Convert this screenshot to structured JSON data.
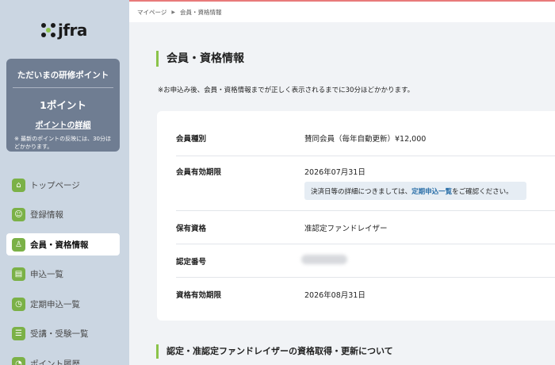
{
  "brand": {
    "logo_text": "jfra"
  },
  "points_card": {
    "title": "ただいまの研修ポイント",
    "value": "1ポイント",
    "link": "ポイントの詳細",
    "note": "※ 最新のポイントの反映には、30分ほどかかります。"
  },
  "nav": {
    "items": [
      {
        "label": "トップページ",
        "icon": "home-icon",
        "glyph": "⌂",
        "active": false
      },
      {
        "label": "登録情報",
        "icon": "id-card-icon",
        "glyph": "☺",
        "active": false
      },
      {
        "label": "会員・資格情報",
        "icon": "badge-icon",
        "glyph": "♙",
        "active": true
      },
      {
        "label": "申込一覧",
        "icon": "card-icon",
        "glyph": "▤",
        "active": false
      },
      {
        "label": "定期申込一覧",
        "icon": "clock-icon",
        "glyph": "◷",
        "active": false
      },
      {
        "label": "受講・受験一覧",
        "icon": "list-icon",
        "glyph": "☰",
        "active": false
      },
      {
        "label": "ポイント履歴",
        "icon": "history-icon",
        "glyph": "◔",
        "active": false
      }
    ]
  },
  "breadcrumb": {
    "parent": "マイページ",
    "current": "会員・資格情報"
  },
  "page": {
    "title": "会員・資格情報",
    "notice": "※お申込み後、会員・資格情報までが正しく表示されるまでに30分ほどかかります。"
  },
  "info": {
    "membership_type_label": "会員種別",
    "membership_type_value": "賛同会員（毎年自動更新）¥12,000",
    "membership_expiry_label": "会員有効期限",
    "membership_expiry_value": "2026年07月31日",
    "payment_note_prefix": "決済日等の詳細につきましては、",
    "payment_note_link": "定期申込一覧",
    "payment_note_suffix": "をご確認ください。",
    "qualification_label": "保有資格",
    "qualification_value": "准認定ファンドレイザー",
    "cert_number_label": "認定番号",
    "qualification_expiry_label": "資格有効期限",
    "qualification_expiry_value": "2026年08月31日"
  },
  "section": {
    "title": "認定・准認定ファンドレイザーの資格取得・更新について"
  },
  "colors": {
    "accent": "#8bc34a",
    "sidebar": "#cbd6e2",
    "card": "#6f7d92",
    "link": "#2b6fa8"
  }
}
